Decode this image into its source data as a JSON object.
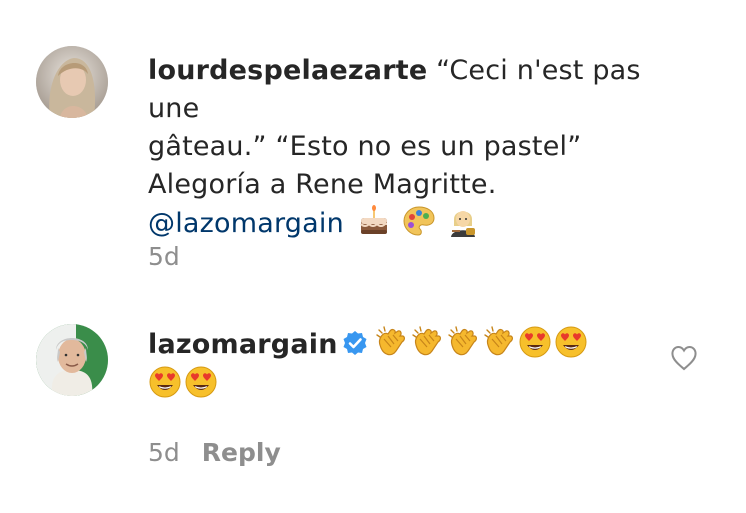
{
  "comments": [
    {
      "username": "lourdespelaezarte",
      "text_line1": " “Ceci n'est pas une",
      "text_line2": "gâteau.” “Esto no es un pastel”",
      "text_line3": "Alegoría a Rene Magritte.",
      "mention": "@lazomargain",
      "emojis": [
        "cake-emoji",
        "artist-palette-emoji",
        "woman-artist-emoji"
      ],
      "time": "5d"
    },
    {
      "username": "lazomargain",
      "verified": true,
      "emojis_line1": [
        "clapping-hands-emoji",
        "clapping-hands-emoji",
        "clapping-hands-emoji",
        "clapping-hands-emoji",
        "heart-eyes-emoji",
        "heart-eyes-emoji"
      ],
      "emojis_line2": [
        "heart-eyes-emoji",
        "heart-eyes-emoji"
      ],
      "time": "5d",
      "reply_label": "Reply"
    }
  ],
  "icons": {
    "like": "heart-outline-icon",
    "verified": "verified-badge-icon"
  },
  "colors": {
    "text": "#262626",
    "secondary": "#8e8e8e",
    "mention": "#00376b",
    "verified": "#3897f0"
  }
}
